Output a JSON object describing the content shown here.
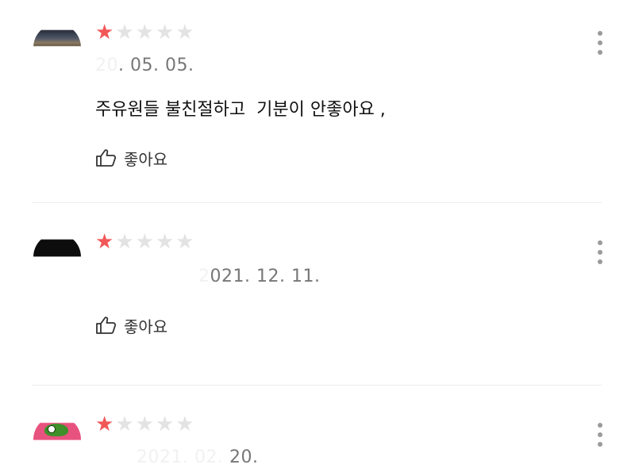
{
  "colors": {
    "star_filled": "#f25757",
    "star_empty": "#e3e3e3",
    "divider": "#ececec",
    "text": "#111111",
    "meta": "#777777"
  },
  "reviews": [
    {
      "rating": 1,
      "max_rating": 5,
      "date_masked": "20",
      "date_visible": ". 05. 05.",
      "text": "주유원들 불친절하고  기분이 안좋아요 ,",
      "like_label": "좋아요",
      "like_icon": "thumbs-up-icon",
      "more_icon": "more-vertical-icon"
    },
    {
      "rating": 1,
      "max_rating": 5,
      "date_masked": "2",
      "date_visible": "021. 12. 11.",
      "text": "",
      "like_label": "좋아요",
      "like_icon": "thumbs-up-icon",
      "more_icon": "more-vertical-icon"
    },
    {
      "rating": 1,
      "max_rating": 5,
      "date_masked": "2021. 02.",
      "date_visible": " 20.",
      "text": "",
      "like_label": "",
      "like_icon": "",
      "more_icon": "more-vertical-icon"
    }
  ]
}
